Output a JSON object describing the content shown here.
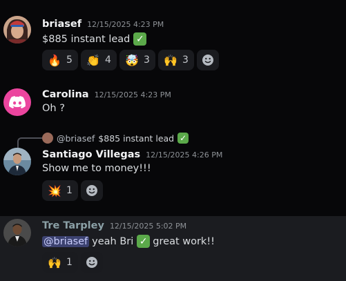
{
  "messages": [
    {
      "username": "briasef",
      "timestamp": "12/15/2025 4:23 PM",
      "text": "$885 instant lead",
      "reactions": [
        {
          "icon": "fire",
          "emoji": "🔥",
          "count": "5"
        },
        {
          "icon": "clapping-hands",
          "emoji": "👏",
          "count": "4"
        },
        {
          "icon": "exploding-head",
          "emoji": "🤯",
          "count": "3"
        },
        {
          "icon": "raising-hands",
          "emoji": "🙌",
          "count": "3"
        }
      ]
    },
    {
      "username": "Carolina",
      "timestamp": "12/15/2025 4:23 PM",
      "text": "Oh ?"
    },
    {
      "reply_to_user": "@briasef",
      "reply_to_text": "$885 instant lead",
      "username": "Santiago Villegas",
      "timestamp": "12/15/2025 4:26 PM",
      "text": "Show me to money!!!",
      "reactions": [
        {
          "icon": "collision",
          "emoji": "💥",
          "count": "1"
        }
      ]
    },
    {
      "username": "Tre Tarpley",
      "timestamp": "12/15/2025 5:02 PM",
      "mention": "@briasef",
      "text_before_check": "yeah Bri",
      "text_after_check": "great work!!",
      "reactions": [
        {
          "icon": "raising-hands",
          "emoji": "🙌",
          "count": "1"
        }
      ]
    }
  ],
  "colors": {
    "background": "#070709",
    "highlight_row": "#1b1c20",
    "tre_username": "#8ba0a6",
    "mention_bg": "#3c4270",
    "check_green": "#5ba94a",
    "carolina_avatar": "#eb459e"
  }
}
